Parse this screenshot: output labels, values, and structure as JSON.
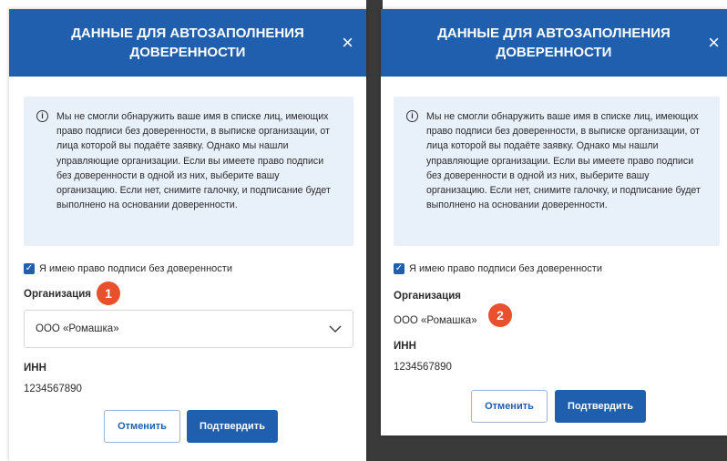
{
  "dialogs": [
    {
      "title": "ДАННЫЕ ДЛЯ АВТОЗАПОЛНЕНИЯ ДОВЕРЕННОСТИ",
      "close_label": "×",
      "info_icon": "i",
      "info_text": "Мы не смогли обнаружить ваше имя в списке лиц, имеющих право подписи без доверенности, в выписке организации, от лица которой вы подаёте заявку. Однако мы нашли управляющие организации. Если вы имеете право подписи без доверенности в одной из них, выберите вашу организацию. Если нет, снимите галочку, и подписание будет выполнено на основании доверенности.",
      "checkbox_label": "Я имею право подписи без доверенности",
      "org_label": "Организация",
      "org_value": "ООО «Ромашка»",
      "inn_label": "ИНН",
      "inn_value": "1234567890",
      "cancel_label": "Отменить",
      "confirm_label": "Подтвердить",
      "badge": "1"
    },
    {
      "title": "ДАННЫЕ ДЛЯ АВТОЗАПОЛНЕНИЯ ДОВЕРЕННОСТИ",
      "close_label": "×",
      "info_icon": "i",
      "info_text": "Мы не смогли обнаружить ваше имя в списке лиц, имеющих право подписи без доверенности, в выписке организации, от лица которой вы подаёте заявку. Однако мы нашли управляющие организации. Если вы имеете право подписи без доверенности в одной из них, выберите вашу организацию. Если нет, снимите галочку, и подписание будет выполнено на основании доверенности.",
      "checkbox_label": "Я имею право подписи без доверенности",
      "org_label": "Организация",
      "org_value": "ООО «Ромашка»",
      "inn_label": "ИНН",
      "inn_value": "1234567890",
      "cancel_label": "Отменить",
      "confirm_label": "Подтвердить",
      "badge": "2"
    }
  ],
  "icons": {
    "close": "close-icon",
    "info": "info-icon",
    "checkbox": "checkmark-icon",
    "select": "chevron-down-icon"
  },
  "colors": {
    "header": "#1f5fae",
    "info_bg": "#e8f0fa",
    "badge": "#e8502e"
  }
}
